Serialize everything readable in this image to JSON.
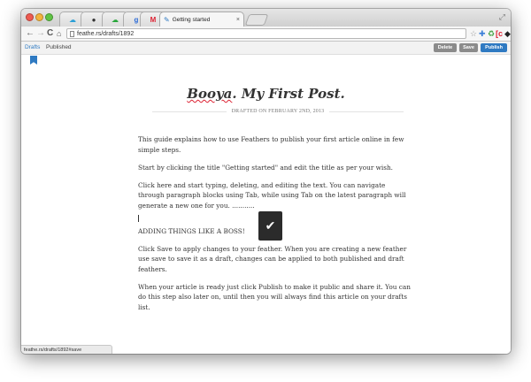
{
  "browser": {
    "tabs": [
      {
        "label": "Getting started",
        "close_glyph": "×"
      }
    ],
    "url": "feathe.rs/drafts/1892",
    "pinned_tabs": [
      "cloud-app-icon",
      "github-icon",
      "cloud-app-icon",
      "google-icon",
      "gmail-icon"
    ],
    "extensions": [
      "star-icon",
      "extension-puzzle-icon",
      "extension-green-icon",
      "extension-red-icon",
      "layers-icon",
      "menu-icon"
    ]
  },
  "app": {
    "nav": {
      "drafts": "Drafts",
      "published": "Published"
    },
    "actions": {
      "delete": "Delete",
      "save": "Save",
      "publish": "Publish"
    }
  },
  "article": {
    "title_word": "Booya",
    "title_rest": ". My First Post.",
    "date_line": "DRAFTED ON FEBRUARY 2ND, 2013",
    "paragraphs": [
      "This guide explains how to use Feathers to publish your first article online in few simple steps.",
      "Start by clicking the title \"Getting started\" and edit the title as per your wish.",
      "Click here and start typing, deleting, and editing the text. You can navigate through paragraph blocks using Tab, while using Tab on the latest paragraph will generate a new one for you. ...........",
      "ADDING THINGS LIKE A BOSS!",
      "Click Save to apply changes to your feather. When you are creating a new feather use save to save it as a draft, changes can be applied to both published and draft feathers.",
      "When your article is ready just click Publish to make it public and share it. You can do this step also later on, until then you will always find this article on your drafts list."
    ]
  },
  "toast": {
    "glyph": "✔"
  },
  "status_url": "feathe.rs/drafts/1892#save",
  "colors": {
    "accent": "#2f7ac2",
    "publish": "#2f7ac2",
    "muted_button": "#8b8b8b"
  }
}
